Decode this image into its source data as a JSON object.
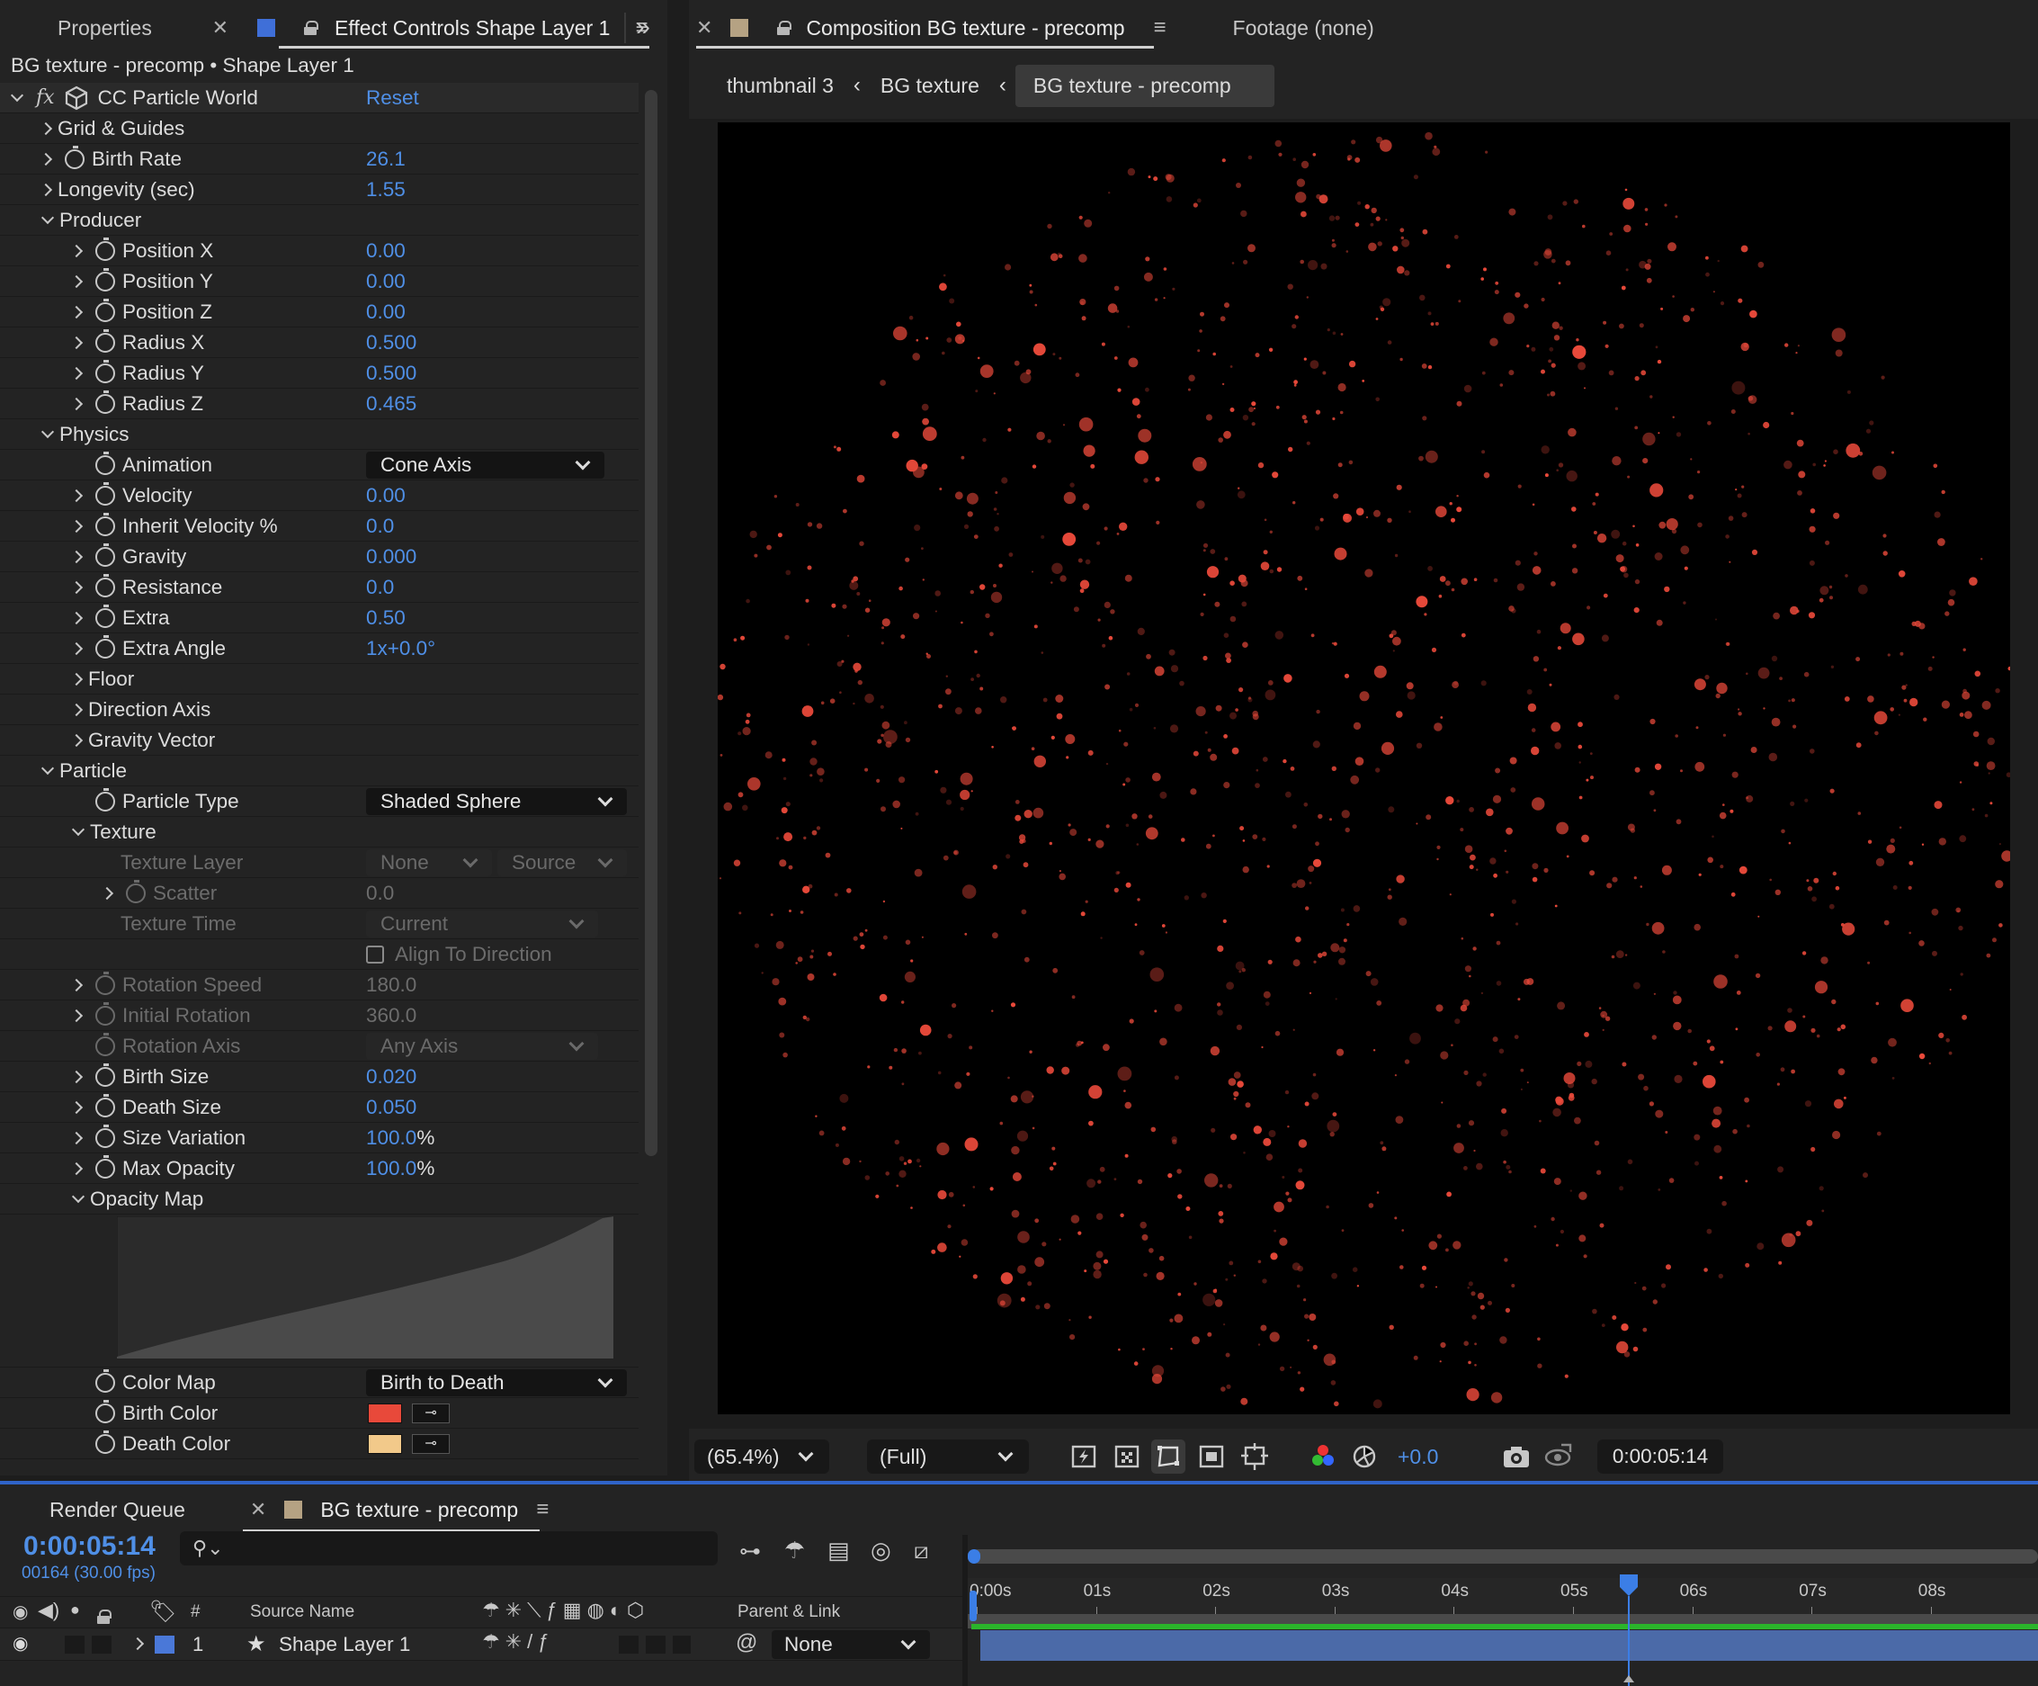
{
  "effect_controls": {
    "tabs": {
      "properties": "Properties",
      "effect_controls": "Effect Controls Shape Layer 1"
    },
    "breadcrumb": "BG texture - precomp • Shape Layer 1",
    "effect_name": "CC Particle World",
    "reset": "Reset",
    "rows": {
      "grid_guides": "Grid & Guides",
      "birth_rate": {
        "label": "Birth Rate",
        "value": "26.1"
      },
      "longevity": {
        "label": "Longevity (sec)",
        "value": "1.55"
      },
      "producer": "Producer",
      "position_x": {
        "label": "Position X",
        "value": "0.00"
      },
      "position_y": {
        "label": "Position Y",
        "value": "0.00"
      },
      "position_z": {
        "label": "Position Z",
        "value": "0.00"
      },
      "radius_x": {
        "label": "Radius X",
        "value": "0.500"
      },
      "radius_y": {
        "label": "Radius Y",
        "value": "0.500"
      },
      "radius_z": {
        "label": "Radius Z",
        "value": "0.465"
      },
      "physics": "Physics",
      "animation": {
        "label": "Animation",
        "value": "Cone Axis"
      },
      "velocity": {
        "label": "Velocity",
        "value": "0.00"
      },
      "inherit_velocity": {
        "label": "Inherit Velocity %",
        "value": "0.0"
      },
      "gravity": {
        "label": "Gravity",
        "value": "0.000"
      },
      "resistance": {
        "label": "Resistance",
        "value": "0.0"
      },
      "extra": {
        "label": "Extra",
        "value": "0.50"
      },
      "extra_angle": {
        "label": "Extra Angle",
        "value": "1x+0.0°"
      },
      "floor": "Floor",
      "direction_axis": "Direction Axis",
      "gravity_vector": "Gravity Vector",
      "particle": "Particle",
      "particle_type": {
        "label": "Particle Type",
        "value": "Shaded Sphere"
      },
      "texture": "Texture",
      "texture_layer": {
        "label": "Texture Layer",
        "value": "None",
        "value2": "Source"
      },
      "scatter": {
        "label": "Scatter",
        "value": "0.0"
      },
      "texture_time": {
        "label": "Texture Time",
        "value": "Current"
      },
      "align_to_direction": {
        "label": "Align To Direction",
        "checked": false
      },
      "rotation_speed": {
        "label": "Rotation Speed",
        "value": "180.0"
      },
      "initial_rotation": {
        "label": "Initial Rotation",
        "value": "360.0"
      },
      "rotation_axis": {
        "label": "Rotation Axis",
        "value": "Any Axis"
      },
      "birth_size": {
        "label": "Birth Size",
        "value": "0.020"
      },
      "death_size": {
        "label": "Death Size",
        "value": "0.050"
      },
      "size_variation": {
        "label": "Size Variation",
        "value": "100.0",
        "unit": "%"
      },
      "max_opacity": {
        "label": "Max Opacity",
        "value": "100.0",
        "unit": "%"
      },
      "opacity_map": "Opacity Map",
      "color_map": {
        "label": "Color Map",
        "value": "Birth to Death"
      },
      "birth_color": {
        "label": "Birth Color",
        "color": "#e8493a"
      },
      "death_color": {
        "label": "Death Color",
        "color": "#f2c98a"
      }
    }
  },
  "composition": {
    "tab_label": "Composition BG texture - precomp",
    "footage_tab": "Footage (none)",
    "breadcrumbs": [
      "thumbnail 3",
      "BG texture",
      "BG texture - precomp"
    ],
    "particle_color": "#e8493a",
    "zoom": "(65.4%)",
    "resolution": "(Full)",
    "exposure": "+0.0",
    "timecode": "0:00:05:14"
  },
  "timeline": {
    "render_queue_tab": "Render Queue",
    "comp_tab": "BG texture - precomp",
    "current_time": "0:00:05:14",
    "frame_info": "00164 (30.00 fps)",
    "search_placeholder": "",
    "columns": {
      "number": "#",
      "source_name": "Source Name",
      "parent_link": "Parent & Link"
    },
    "ruler_labels": [
      "0:00s",
      "01s",
      "02s",
      "03s",
      "04s",
      "05s",
      "06s",
      "07s",
      "08s"
    ],
    "layers": [
      {
        "number": "1",
        "name": "Shape Layer 1",
        "parent": "None",
        "label_color": "#4a78d8"
      }
    ],
    "playhead_seconds": 5.47
  }
}
